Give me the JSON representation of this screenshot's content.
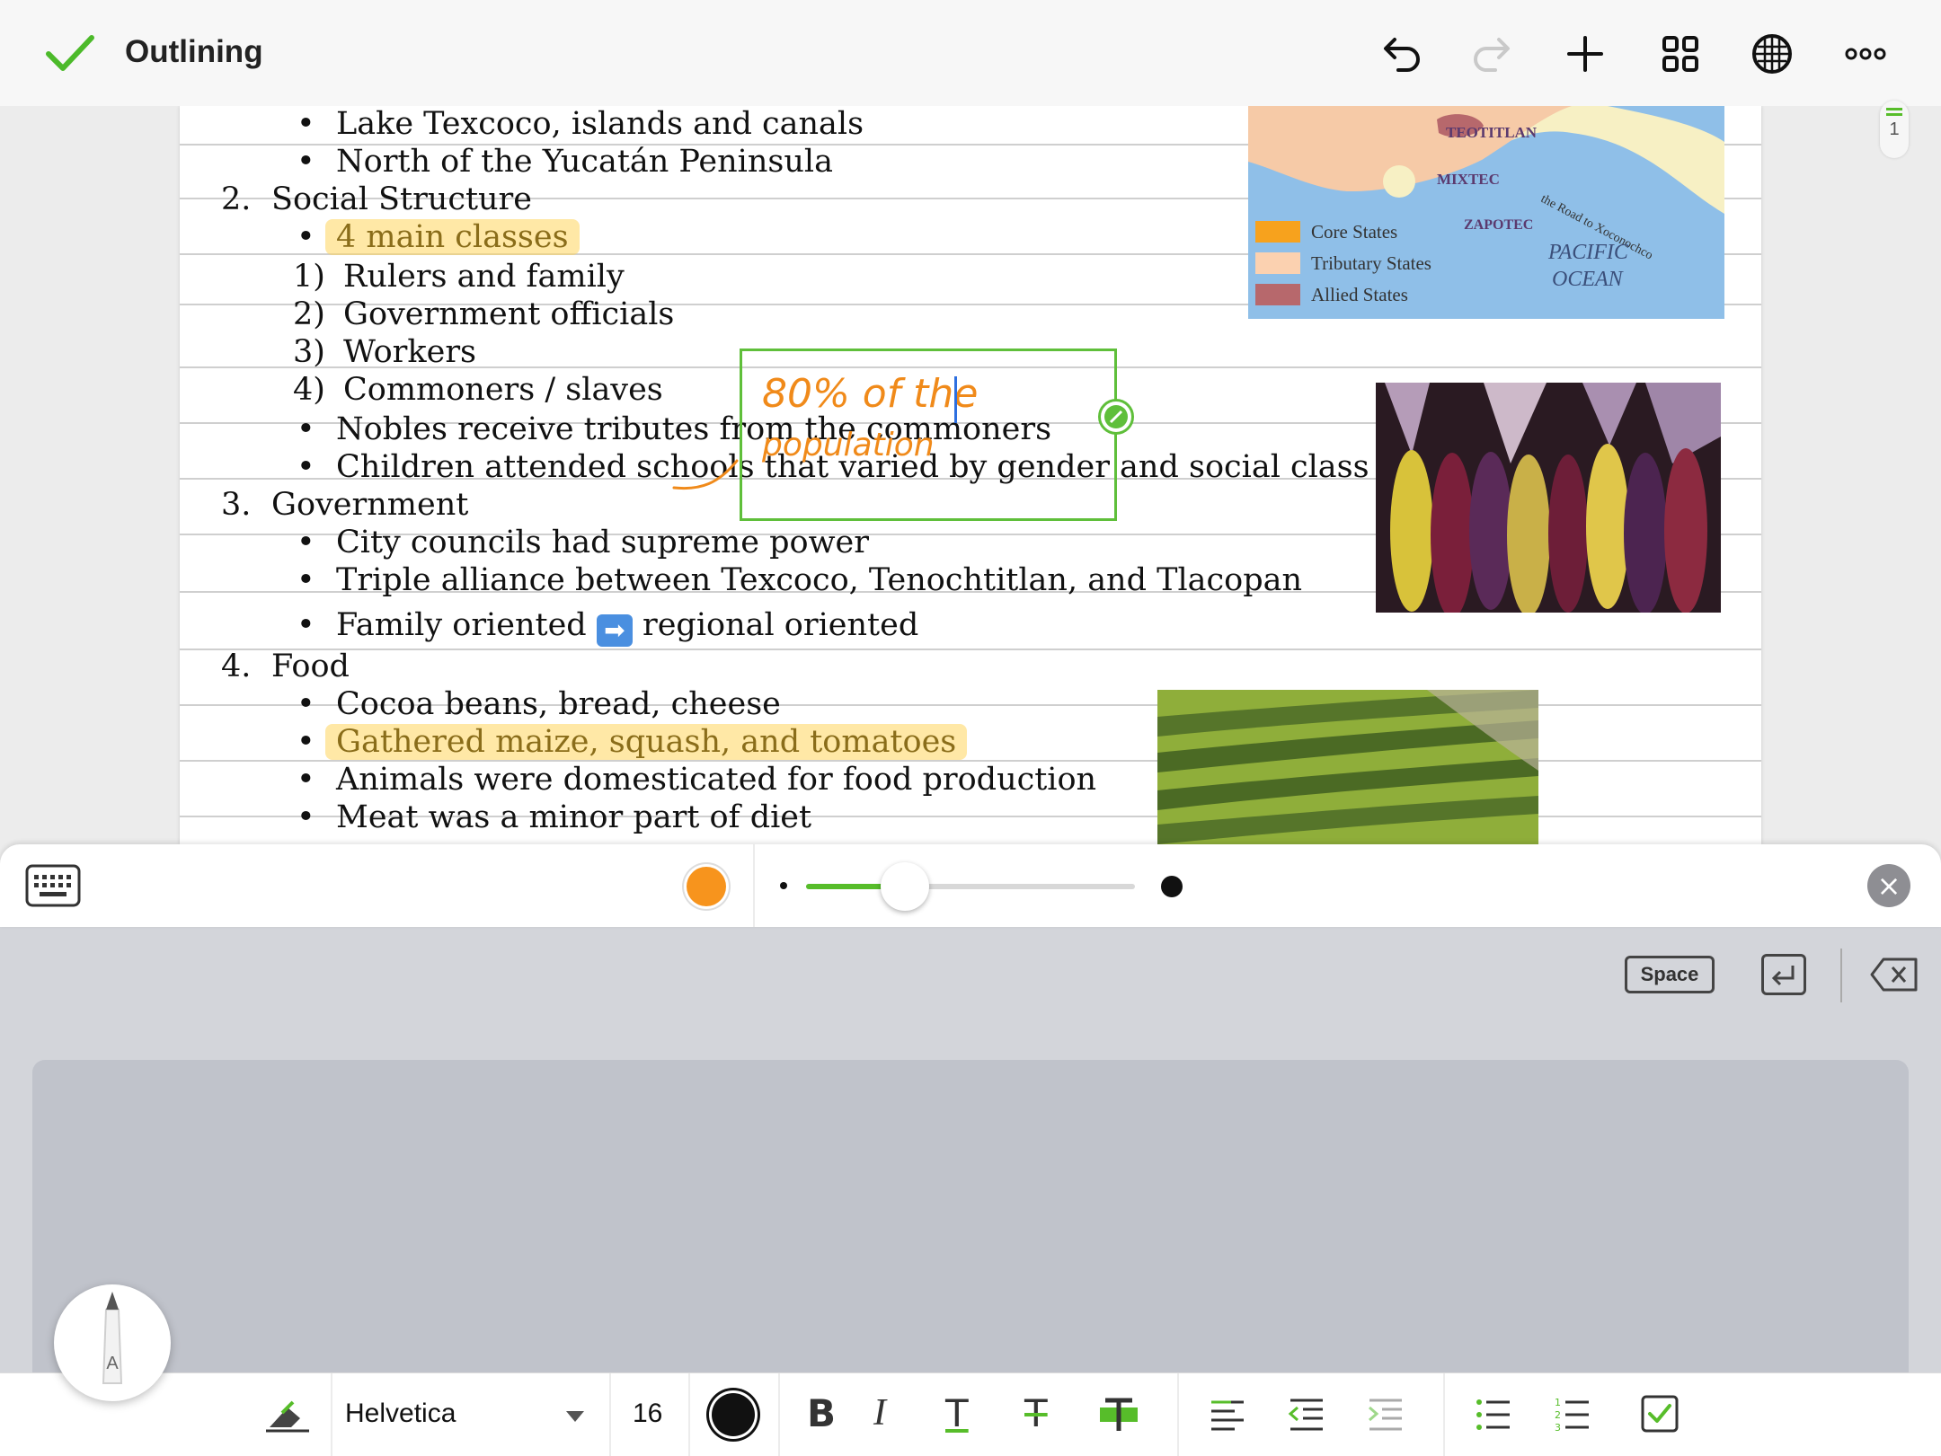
{
  "header": {
    "title": "Outlining",
    "icons": [
      "checkmark-icon",
      "undo-icon",
      "redo-icon",
      "add-icon",
      "grid-icon",
      "globe-icon",
      "more-icon"
    ]
  },
  "page_indicator": {
    "page_number": "1"
  },
  "outline": {
    "lines": [
      {
        "type": "bullet",
        "text": "Lake Texcoco, islands and canals"
      },
      {
        "type": "bullet",
        "text": "North of the Yucatán Peninsula"
      },
      {
        "type": "heading",
        "marker": "2.",
        "text": "Social Structure"
      },
      {
        "type": "bullet",
        "text": "4 main classes",
        "highlight": true
      },
      {
        "type": "sub",
        "marker": "1)",
        "text": "Rulers and family"
      },
      {
        "type": "sub",
        "marker": "2)",
        "text": "Government officials"
      },
      {
        "type": "sub",
        "marker": "3)",
        "text": "Workers"
      },
      {
        "type": "sub",
        "marker": "4)",
        "text": "Commoners / slaves"
      },
      {
        "type": "bullet",
        "text": "Nobles receive tributes from the commoners"
      },
      {
        "type": "bullet",
        "text": "Children attended schools that varied by gender and social class"
      },
      {
        "type": "heading",
        "marker": "3.",
        "text": "Government"
      },
      {
        "type": "bullet",
        "text": "City councils had supreme power"
      },
      {
        "type": "bullet",
        "text": "Triple alliance between Texcoco, Tenochtitlan, and Tlacopan"
      },
      {
        "type": "bullet",
        "text_before": "Family oriented",
        "text_after": "regional oriented"
      },
      {
        "type": "heading",
        "marker": "4.",
        "text": "Food"
      },
      {
        "type": "bullet",
        "text": "Cocoa beans, bread, cheese"
      },
      {
        "type": "bullet",
        "text": "Gathered maize, squash, and tomatoes",
        "highlight": true
      },
      {
        "type": "bullet",
        "text": "Animals were domesticated for food production"
      },
      {
        "type": "bullet",
        "text": "Meat was a minor part of diet"
      }
    ]
  },
  "annotation": {
    "line1": "80% of the",
    "line2": "population",
    "ink_color": "#f08a1a"
  },
  "map_image": {
    "regions": [
      "TEOTITLAN",
      "MIXTEC",
      "ZAPOTEC"
    ],
    "road": "the Road to Xoconochco",
    "ocean": [
      "PACIFIC",
      "OCEAN"
    ],
    "legend": [
      {
        "label": "Core States",
        "color": "#f7a21d"
      },
      {
        "label": "Tributary States",
        "color": "#fbd1b0"
      },
      {
        "label": "Allied States",
        "color": "#b7686c"
      }
    ]
  },
  "pen_toolbar": {
    "pen_color": "#f7941d",
    "stroke_size_fraction": 0.3,
    "accent": "#57bd2a"
  },
  "handwriting_keys": {
    "space_label": "Space"
  },
  "format_bar": {
    "font_name": "Helvetica",
    "font_size": "16",
    "text_color": "#111111"
  }
}
